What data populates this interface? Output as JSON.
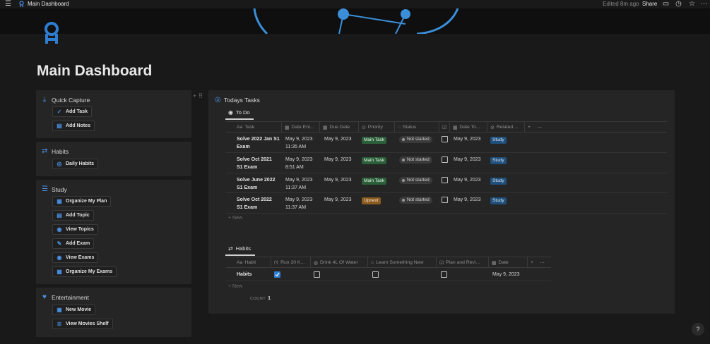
{
  "topbar": {
    "title": "Main Dashboard",
    "edited": "Edited 8m ago",
    "share": "Share"
  },
  "page": {
    "title": "Main Dashboard"
  },
  "sidebar": {
    "quick_capture": {
      "title": "Quick Capture",
      "buttons": [
        "Add Task",
        "Add Notes"
      ]
    },
    "habits": {
      "title": "Habits",
      "buttons": [
        "Daily Habits"
      ]
    },
    "study": {
      "title": "Study",
      "buttons": [
        "Organize My Plan",
        "Add Topic",
        "View Topics",
        "Add Exam",
        "View Exams",
        "Organize My Exams"
      ]
    },
    "entertainment": {
      "title": "Entertainment",
      "buttons": [
        "New Movie",
        "View Movies Shelf"
      ]
    }
  },
  "todays_tasks": {
    "title": "Todays Tasks",
    "tab": "To Do",
    "columns": [
      "Task",
      "Date Ent...",
      "Due Date",
      "Priority",
      "Status",
      "",
      "Date To...",
      "Related ..."
    ],
    "rows": [
      {
        "task1": "Solve 2022 Jan S1",
        "task2": "Exam",
        "entered1": "May 9, 2023",
        "entered2": "11:35 AM",
        "due": "May 9, 2023",
        "priority": "Main Task",
        "status": "Not started",
        "date_to": "May 9, 2023",
        "related": "Study"
      },
      {
        "task1": "Solve Oct 2021",
        "task2": "S1 Exam",
        "entered1": "May 9, 2023",
        "entered2": "8:51 AM",
        "due": "May 9, 2023",
        "priority": "Main Task",
        "status": "Not started",
        "date_to": "May 9, 2023",
        "related": "Study"
      },
      {
        "task1": "Solve June 2022",
        "task2": "S1 Exam",
        "entered1": "May 9, 2023",
        "entered2": "11:37 AM",
        "due": "May 9, 2023",
        "priority": "Main Task",
        "status": "Not started",
        "date_to": "May 9, 2023",
        "related": "Study"
      },
      {
        "task1": "Solve Oct 2022",
        "task2": "S1 Exam",
        "entered1": "May 9, 2023",
        "entered2": "11:37 AM",
        "due": "May 9, 2023",
        "priority": "Upnext",
        "status": "Not started",
        "date_to": "May 9, 2023",
        "related": "Study"
      }
    ],
    "new_label": "New"
  },
  "habits_table": {
    "tab": "Habits",
    "columns": [
      "Habit",
      "Run 20 K...",
      "Drink 4L Of Water",
      "Learn Something New",
      "Plan and Revi...",
      "Date"
    ],
    "row": {
      "name": "Habits",
      "run": true,
      "drink": false,
      "learn": false,
      "plan": false,
      "date": "May 9, 2023"
    },
    "new_label": "New",
    "count_label": "COUNT",
    "count_value": "1"
  },
  "colors": {
    "accent": "#2e7dd1",
    "main_task": "#2b5f3a",
    "upnext": "#8a5a1e",
    "study": "#1f4f7a"
  }
}
